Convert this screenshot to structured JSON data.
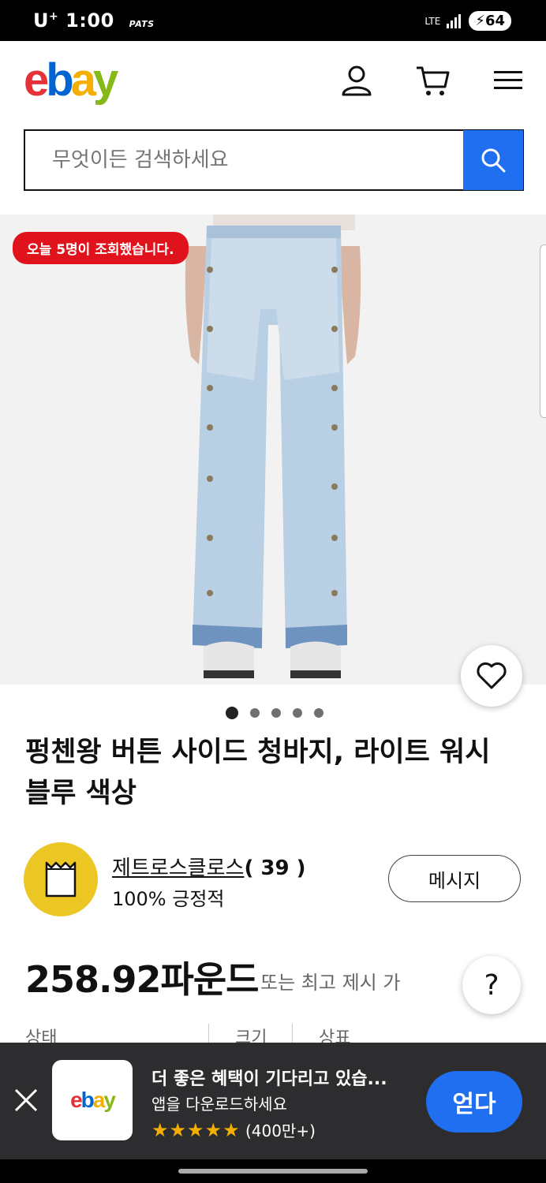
{
  "status": {
    "carrier": "U",
    "carrier_sup": "+",
    "time": "1:00",
    "extra": "PATS",
    "network": "LTE",
    "battery": "64"
  },
  "header": {
    "logo": {
      "e": "e",
      "b": "b",
      "a": "a",
      "y": "y"
    }
  },
  "search": {
    "placeholder": "무엇이든 검색하세요"
  },
  "gallery": {
    "badge": "오늘 5명이 조회했습니다.",
    "dots": 5,
    "active_dot": 0
  },
  "product": {
    "title": "펑첸왕 버튼 사이드 청바지, 라이트 워시 블루 색상"
  },
  "seller": {
    "name": "제트로스클로스",
    "score": "( 39 )",
    "positive": "100% 긍정적",
    "message_label": "메시지"
  },
  "price": {
    "amount": "258.92파운드",
    "note": "또는 최고 제시 가",
    "help": "?"
  },
  "specs": {
    "condition": "상태",
    "size": "크기",
    "brand": "상표"
  },
  "banner": {
    "title": "더 좋은 혜택이 기다리고 있습...",
    "subtitle": "앱을 다운로드하세요",
    "stars": "★★★★★",
    "reviews": "(400만+)",
    "get_label": "얻다",
    "app_logo": {
      "e": "e",
      "b": "b",
      "a": "a",
      "y": "y"
    }
  },
  "colors": {
    "accent": "#1f6ff0",
    "badge": "#e0131d",
    "seller_avatar": "#ecc724",
    "banner_bg": "#2d2d30"
  }
}
